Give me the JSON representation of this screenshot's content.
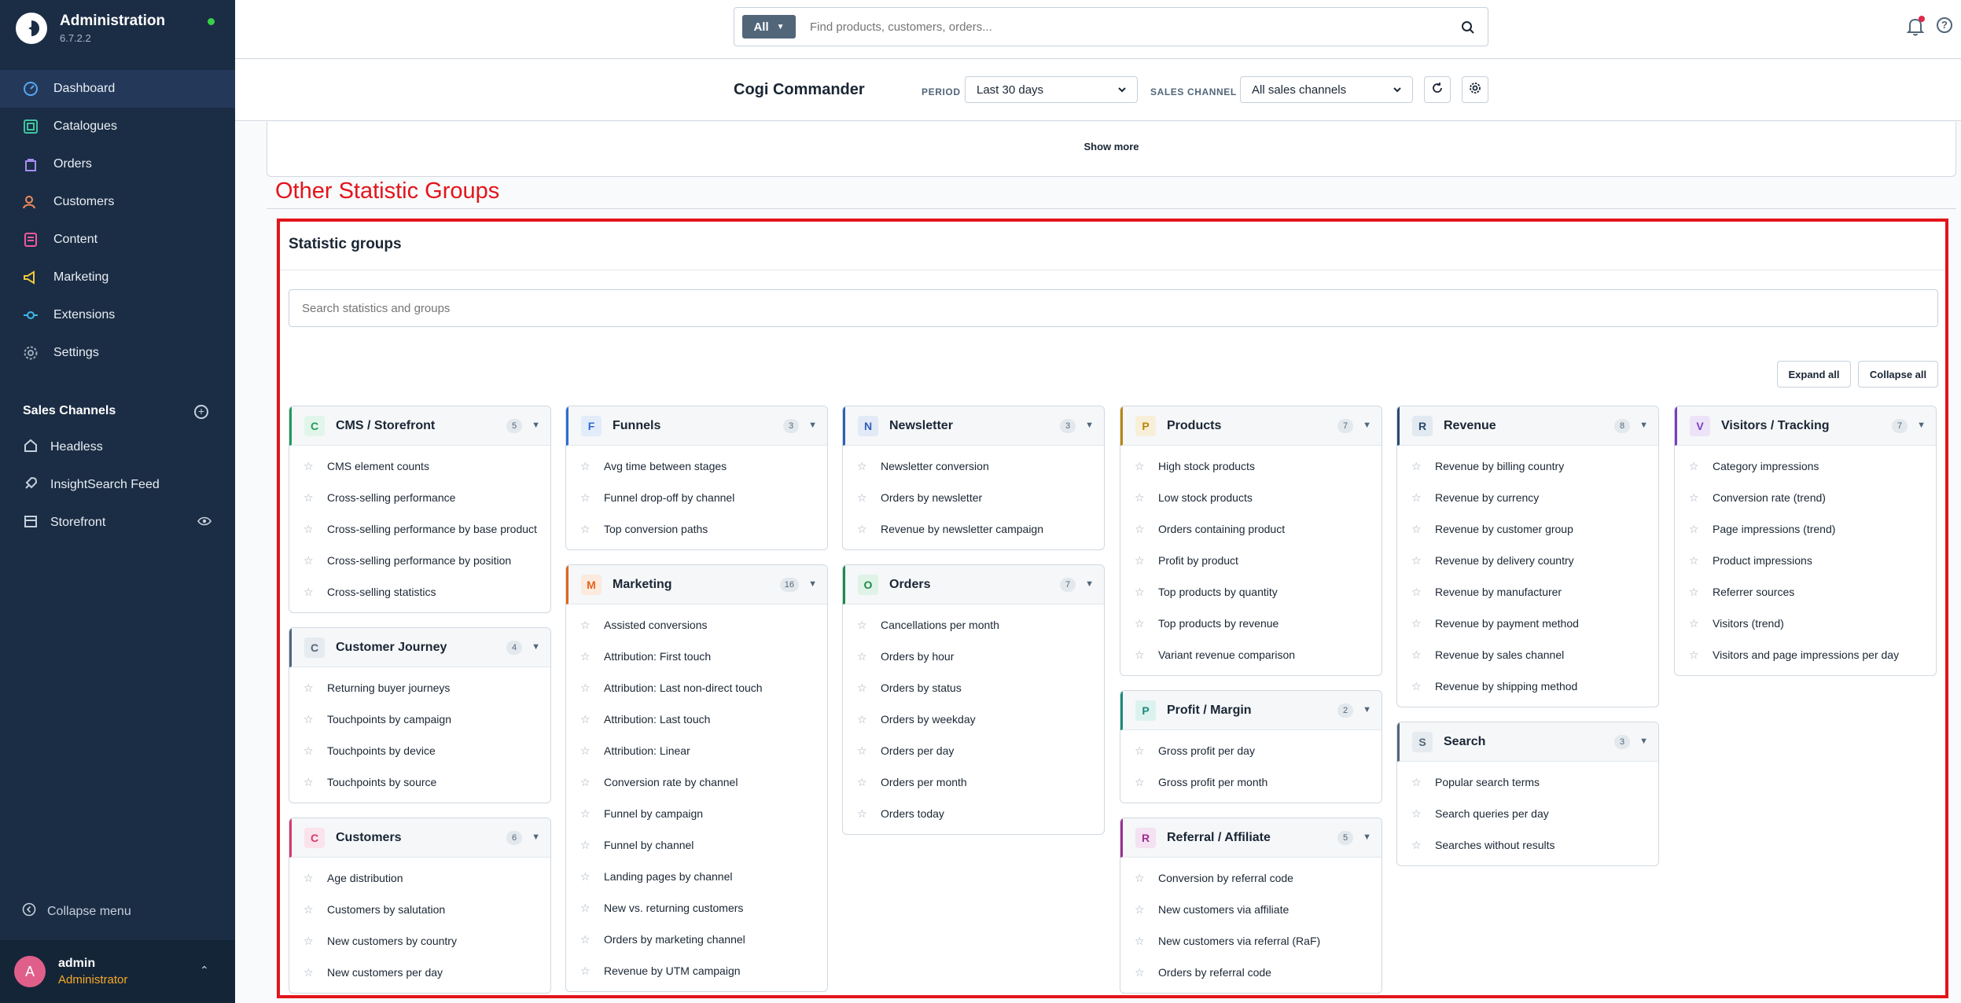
{
  "app": {
    "title": "Administration",
    "version": "6.7.2.2"
  },
  "nav": [
    {
      "label": "Dashboard",
      "icon": "dashboard-icon"
    },
    {
      "label": "Catalogues",
      "icon": "catalogue-icon"
    },
    {
      "label": "Orders",
      "icon": "orders-icon"
    },
    {
      "label": "Customers",
      "icon": "customers-icon"
    },
    {
      "label": "Content",
      "icon": "content-icon"
    },
    {
      "label": "Marketing",
      "icon": "marketing-icon"
    },
    {
      "label": "Extensions",
      "icon": "extensions-icon"
    },
    {
      "label": "Settings",
      "icon": "settings-icon"
    }
  ],
  "sales_channels": {
    "title": "Sales Channels",
    "items": [
      {
        "label": "Headless",
        "icon": "headless-icon"
      },
      {
        "label": "InsightSearch Feed",
        "icon": "rocket-icon"
      },
      {
        "label": "Storefront",
        "icon": "storefront-icon"
      }
    ]
  },
  "collapse_menu": "Collapse menu",
  "user": {
    "initial": "A",
    "name": "admin",
    "role": "Administrator"
  },
  "search": {
    "type": "All",
    "placeholder": "Find products, customers, orders..."
  },
  "smartbar": {
    "title": "Cogi Commander",
    "period_label": "PERIOD",
    "period_value": "Last 30 days",
    "channel_label": "SALES CHANNEL",
    "channel_value": "All sales channels"
  },
  "show_more": "Show more",
  "section_heading": "Other Statistic Groups",
  "groups_card": {
    "title": "Statistic groups",
    "search_placeholder": "Search statistics and groups",
    "expand_all": "Expand all",
    "collapse_all": "Collapse all"
  },
  "columns": [
    [
      {
        "letter": "C",
        "name": "CMS / Storefront",
        "count": "5",
        "color": "#1f9a5a",
        "light": "#e2f5ea",
        "items": [
          "CMS element counts",
          "Cross-selling performance",
          "Cross-selling performance by base product",
          "Cross-selling performance by position",
          "Cross-selling statistics"
        ]
      },
      {
        "letter": "C",
        "name": "Customer Journey",
        "count": "4",
        "color": "#52667a",
        "light": "#e6ebf0",
        "items": [
          "Returning buyer journeys",
          "Touchpoints by campaign",
          "Touchpoints by device",
          "Touchpoints by source"
        ]
      },
      {
        "letter": "C",
        "name": "Customers",
        "count": "6",
        "color": "#d43a6a",
        "light": "#fbe3eb",
        "items": [
          "Age distribution",
          "Customers by salutation",
          "New customers by country",
          "New customers per day"
        ]
      }
    ],
    [
      {
        "letter": "F",
        "name": "Funnels",
        "count": "3",
        "color": "#2f6bd0",
        "light": "#e2ecfa",
        "items": [
          "Avg time between stages",
          "Funnel drop-off by channel",
          "Top conversion paths"
        ]
      },
      {
        "letter": "M",
        "name": "Marketing",
        "count": "16",
        "color": "#e0651a",
        "light": "#fceadf",
        "items": [
          "Assisted conversions",
          "Attribution: First touch",
          "Attribution: Last non-direct touch",
          "Attribution: Last touch",
          "Attribution: Linear",
          "Conversion rate by channel",
          "Funnel by campaign",
          "Funnel by channel",
          "Landing pages by channel",
          "New vs. returning customers",
          "Orders by marketing channel",
          "Revenue by UTM campaign"
        ]
      }
    ],
    [
      {
        "letter": "N",
        "name": "Newsletter",
        "count": "3",
        "color": "#2f5fb8",
        "light": "#e2eaf7",
        "items": [
          "Newsletter conversion",
          "Orders by newsletter",
          "Revenue by newsletter campaign"
        ]
      },
      {
        "letter": "O",
        "name": "Orders",
        "count": "7",
        "color": "#1e8a4c",
        "light": "#dff3e7",
        "items": [
          "Cancellations per month",
          "Orders by hour",
          "Orders by status",
          "Orders by weekday",
          "Orders per day",
          "Orders per month",
          "Orders today"
        ]
      }
    ],
    [
      {
        "letter": "P",
        "name": "Products",
        "count": "7",
        "color": "#b8860b",
        "light": "#f8efd9",
        "items": [
          "High stock products",
          "Low stock products",
          "Orders containing product",
          "Profit by product",
          "Top products by quantity",
          "Top products by revenue",
          "Variant revenue comparison"
        ]
      },
      {
        "letter": "P",
        "name": "Profit / Margin",
        "count": "2",
        "color": "#1a8a7a",
        "light": "#dcf2ee",
        "items": [
          "Gross profit per day",
          "Gross profit per month"
        ]
      },
      {
        "letter": "R",
        "name": "Referral / Affiliate",
        "count": "5",
        "color": "#9b2f8f",
        "light": "#f4e1f1",
        "items": [
          "Conversion by referral code",
          "New customers via affiliate",
          "New customers via referral (RaF)",
          "Orders by referral code"
        ]
      }
    ],
    [
      {
        "letter": "R",
        "name": "Revenue",
        "count": "8",
        "color": "#2a4a6e",
        "light": "#e2e9f1",
        "items": [
          "Revenue by billing country",
          "Revenue by currency",
          "Revenue by customer group",
          "Revenue by delivery country",
          "Revenue by manufacturer",
          "Revenue by payment method",
          "Revenue by sales channel",
          "Revenue by shipping method"
        ]
      },
      {
        "letter": "S",
        "name": "Search",
        "count": "3",
        "color": "#52667a",
        "light": "#e6ebf0",
        "items": [
          "Popular search terms",
          "Search queries per day",
          "Searches without results"
        ]
      }
    ],
    [
      {
        "letter": "V",
        "name": "Visitors / Tracking",
        "count": "7",
        "color": "#7a3fbf",
        "light": "#ede3f8",
        "items": [
          "Category impressions",
          "Conversion rate (trend)",
          "Page impressions (trend)",
          "Product impressions",
          "Referrer sources",
          "Visitors (trend)",
          "Visitors and page impressions per day"
        ]
      }
    ]
  ]
}
